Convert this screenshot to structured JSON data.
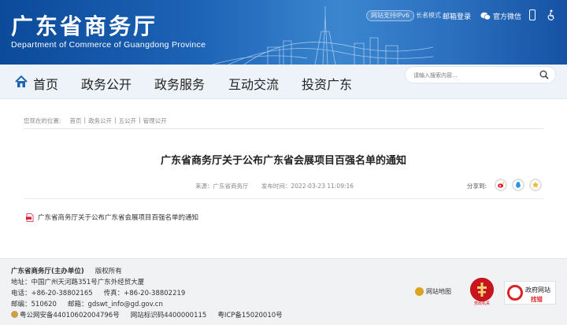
{
  "header": {
    "title": "广东省商务厅",
    "subtitle": "Department of Commerce of Guangdong Province",
    "ipv6_badge": "网站支持IPv6",
    "elder_mode": "长者模式",
    "mail_login": "邮箱登录",
    "wechat": "官方微信",
    "icons": [
      "mobile-icon",
      "accessibility-icon",
      "wechat-icon"
    ]
  },
  "nav": {
    "items": [
      "首页",
      "政务公开",
      "政务服务",
      "互动交流",
      "投资广东"
    ],
    "search_placeholder": "请输入搜索内容..."
  },
  "breadcrumb": {
    "prefix": "您现在的位置:",
    "items": [
      "首页",
      "政务公开",
      "五公开",
      "管理公开"
    ]
  },
  "article": {
    "title": "广东省商务厅关于公布广东省会展项目百强名单的通知",
    "source": "来源：广东省商务厅",
    "publish_time": "发布时间：2022-03-23 11:09:16",
    "share_label": "分享到:",
    "attachment": "广东省商务厅关于公布广东省会展项目百强名单的通知"
  },
  "footer": {
    "org": "广东省商务厅(主办单位)",
    "copyright": "版权所有",
    "address": "地址：中国广州天河路351号广东外经贸大厦",
    "phone": "电话：+86-20-38802165",
    "fax": "传真：+86-20-38802219",
    "postcode": "邮编：510620",
    "email": "邮箱：gdswt_info@gd.gov.cn",
    "police_record": "粤公网安备44010602004796号",
    "site_code": "网站标识码4400000115",
    "icp": "粤ICP备15020010号",
    "sitemap": "网站地图",
    "gov_logo_label": "党政机关",
    "correction_line1": "政府网站",
    "correction_line2": "找错"
  },
  "colors": {
    "banner": "#1d63b6",
    "nav_bg": "#eef3f9",
    "footer_bg": "#f1f2f4",
    "accent_red": "#c8161d"
  }
}
